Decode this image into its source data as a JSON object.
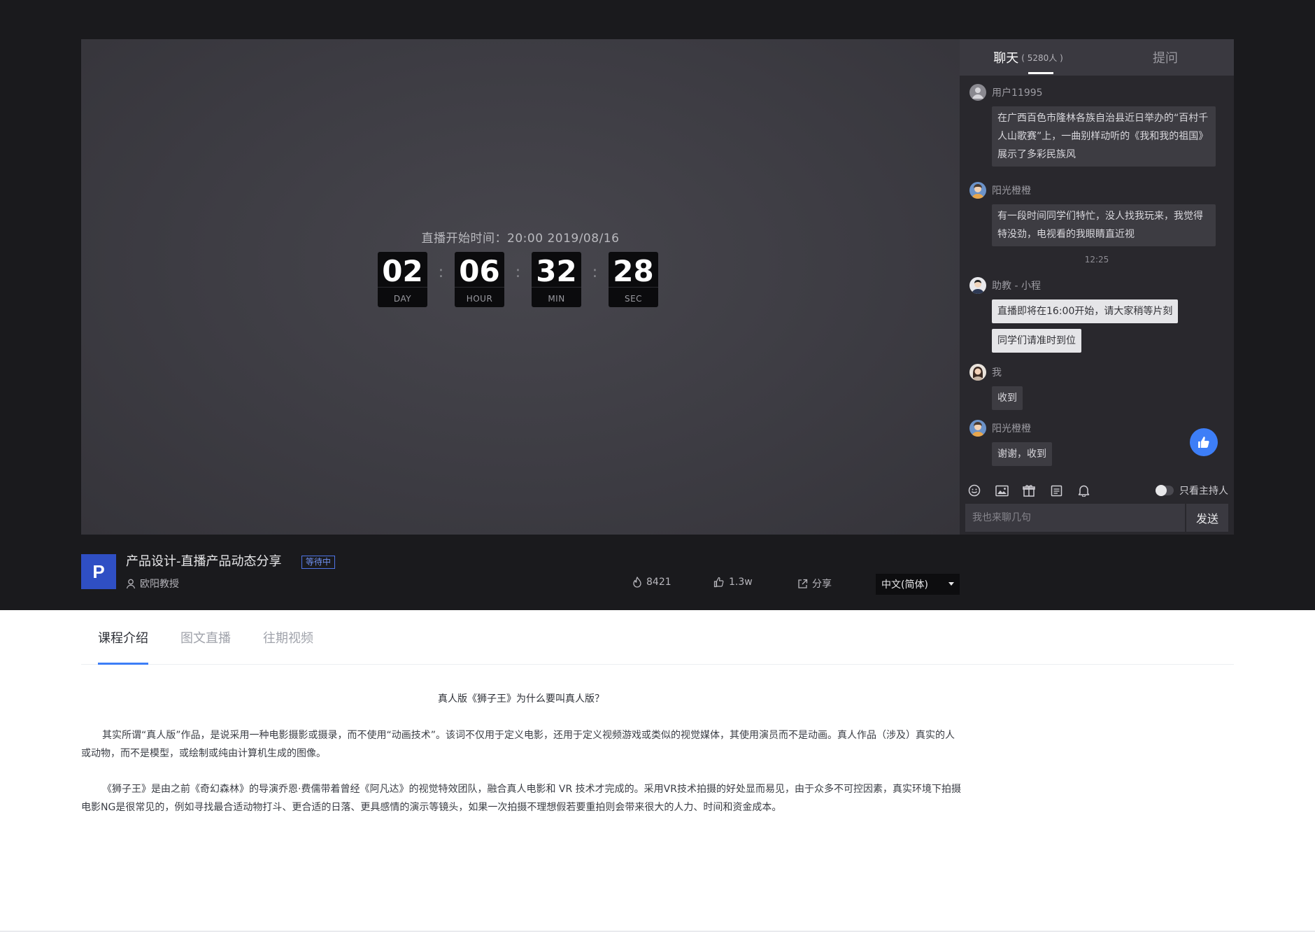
{
  "player": {
    "start_label": "直播开始时间：20:00  2019/08/16",
    "countdown": [
      {
        "value": "02",
        "unit": "DAY"
      },
      {
        "value": "06",
        "unit": "HOUR"
      },
      {
        "value": "32",
        "unit": "MIN"
      },
      {
        "value": "28",
        "unit": "SEC"
      }
    ],
    "separator": ":"
  },
  "chat": {
    "tabs": [
      {
        "label": "聊天",
        "count": "( 5280人 )"
      },
      {
        "label": "提问"
      }
    ],
    "messages": [
      {
        "user": "用户11995",
        "bubbles": [
          "在广西百色市隆林各族自治县近日举办的“百村千人山歌赛”上，一曲别样动听的《我和我的祖国》展示了多彩民族风"
        ]
      },
      {
        "user": "阳光橙橙",
        "bubbles": [
          "有一段时间同学们特忙，没人找我玩来，我觉得特没劲，电视看的我眼睛直近视"
        ]
      },
      {
        "user": "助教 - 小程",
        "bubbles": [
          "直播即将在16:00开始，请大家稍等片刻",
          "同学们请准时到位"
        ]
      },
      {
        "user": "我",
        "bubbles": [
          "收到"
        ]
      },
      {
        "user": "阳光橙橙",
        "bubbles": [
          "谢谢，收到"
        ]
      }
    ],
    "timestamp": "12:25",
    "toolbar_icons": [
      "emoji-icon",
      "image-icon",
      "gift-icon",
      "notes-icon",
      "bell-icon"
    ],
    "host_only_label": "只看主持人",
    "input_placeholder": "我也来聊几句",
    "send_label": "发送"
  },
  "info": {
    "logo_letter": "P",
    "title": "产品设计-直播产品动态分享",
    "status": "等待中",
    "teacher": "欧阳教授",
    "views": "8421",
    "likes": "1.3w",
    "share_label": "分享",
    "language": "中文(简体)"
  },
  "content_tabs": [
    "课程介绍",
    "图文直播",
    "往期视频"
  ],
  "article": {
    "title": "真人版《狮子王》为什么要叫真人版？",
    "paragraphs": [
      "其实所谓“真人版”作品，是说采用一种电影摄影或摄录，而不使用“动画技术”。该词不仅用于定义电影，还用于定义视频游戏或类似的视觉媒体，其使用演员而不是动画。真人作品（涉及）真实的人或动物，而不是模型，或绘制或纯由计算机生成的图像。",
      "《狮子王》是由之前《奇幻森林》的导演乔恩·费儒带着曾经《阿凡达》的视觉特效团队，融合真人电影和 VR 技术才完成的。采用VR技术拍摄的好处显而易见，由于众多不可控因素，真实环境下拍摄电影NG是很常见的，例如寻找最合适动物打斗、更合适的日落、更具感情的演示等镜头，如果一次拍摄不理想假若要重拍则会带来很大的人力、时间和资金成本。"
    ]
  },
  "colors": {
    "accent": "#3d7ef7",
    "logo": "#2f4fc4",
    "dark_bg": "#1a1a1d"
  }
}
